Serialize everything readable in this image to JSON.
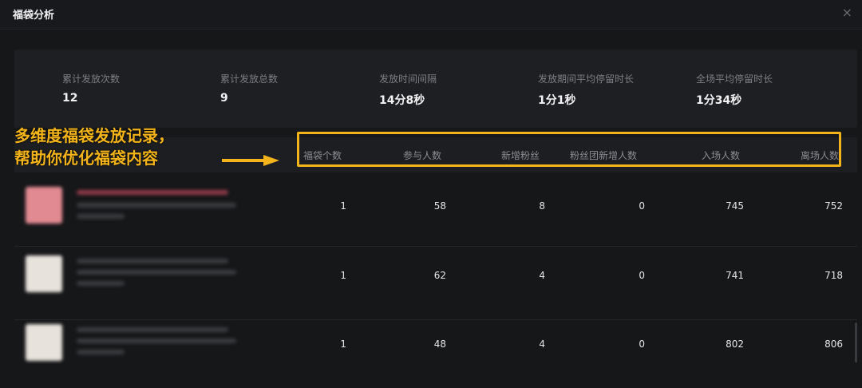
{
  "header": {
    "title": "福袋分析",
    "close_icon": "×"
  },
  "stats": [
    {
      "label": "累计发放次数",
      "value": "12"
    },
    {
      "label": "累计发放总数",
      "value": "9"
    },
    {
      "label": "发放时间间隔",
      "value": "14分8秒"
    },
    {
      "label": "发放期间平均停留时长",
      "value": "1分1秒"
    },
    {
      "label": "全场平均停留时长",
      "value": "1分34秒"
    }
  ],
  "annotation": {
    "line1": "多维度福袋发放记录，",
    "line2": "帮助你优化福袋内容",
    "color": "#f3b31a"
  },
  "table": {
    "columns": [
      "福袋个数",
      "参与人数",
      "新增粉丝",
      "粉丝团新增人数",
      "入场人数",
      "离场人数"
    ],
    "rows": [
      {
        "cells": [
          "1",
          "58",
          "8",
          "0",
          "745",
          "752"
        ]
      },
      {
        "cells": [
          "1",
          "62",
          "4",
          "0",
          "741",
          "718"
        ]
      },
      {
        "cells": [
          "1",
          "48",
          "4",
          "0",
          "802",
          "806"
        ]
      }
    ]
  }
}
